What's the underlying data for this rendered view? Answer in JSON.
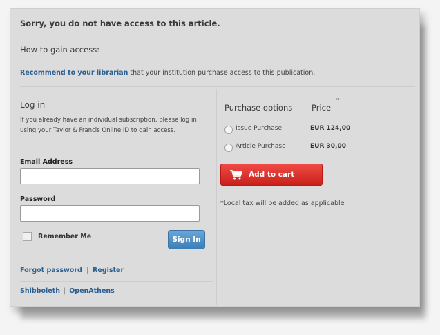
{
  "header": {
    "title": "Sorry, you do not have access to this article.",
    "how_to": "How to gain access:",
    "recommend_link": "Recommend to your librarian",
    "recommend_rest": " that your institution purchase access to this publication."
  },
  "login": {
    "title": "Log in",
    "description": "If you already have an individual subscription, please log in using your Taylor & Francis Online ID to gain access.",
    "email_label": "Email Address",
    "email_value": "",
    "password_label": "Password",
    "password_value": "",
    "remember_label": "Remember Me",
    "remember_checked": false,
    "signin_label": "Sign In",
    "forgot_label": "Forgot password",
    "register_label": "Register",
    "shibboleth_label": "Shibboleth",
    "openathens_label": "OpenAthens"
  },
  "purchase": {
    "header": "Purchase options",
    "price_header": "Price",
    "price_star": "*",
    "options": [
      {
        "label": "Issue Purchase",
        "price": "EUR 124,00",
        "selected": false
      },
      {
        "label": "Article Purchase",
        "price": "EUR 30,00",
        "selected": false
      }
    ],
    "add_to_cart": "Add to cart",
    "tax_note": "*Local tax will be added as applicable"
  },
  "colors": {
    "link": "#2b5e91",
    "cart_button": "#d9312b",
    "signin_button": "#4a8ac2",
    "panel": "#dcdcdc"
  },
  "icons": {
    "cart": "shopping-cart-icon"
  }
}
